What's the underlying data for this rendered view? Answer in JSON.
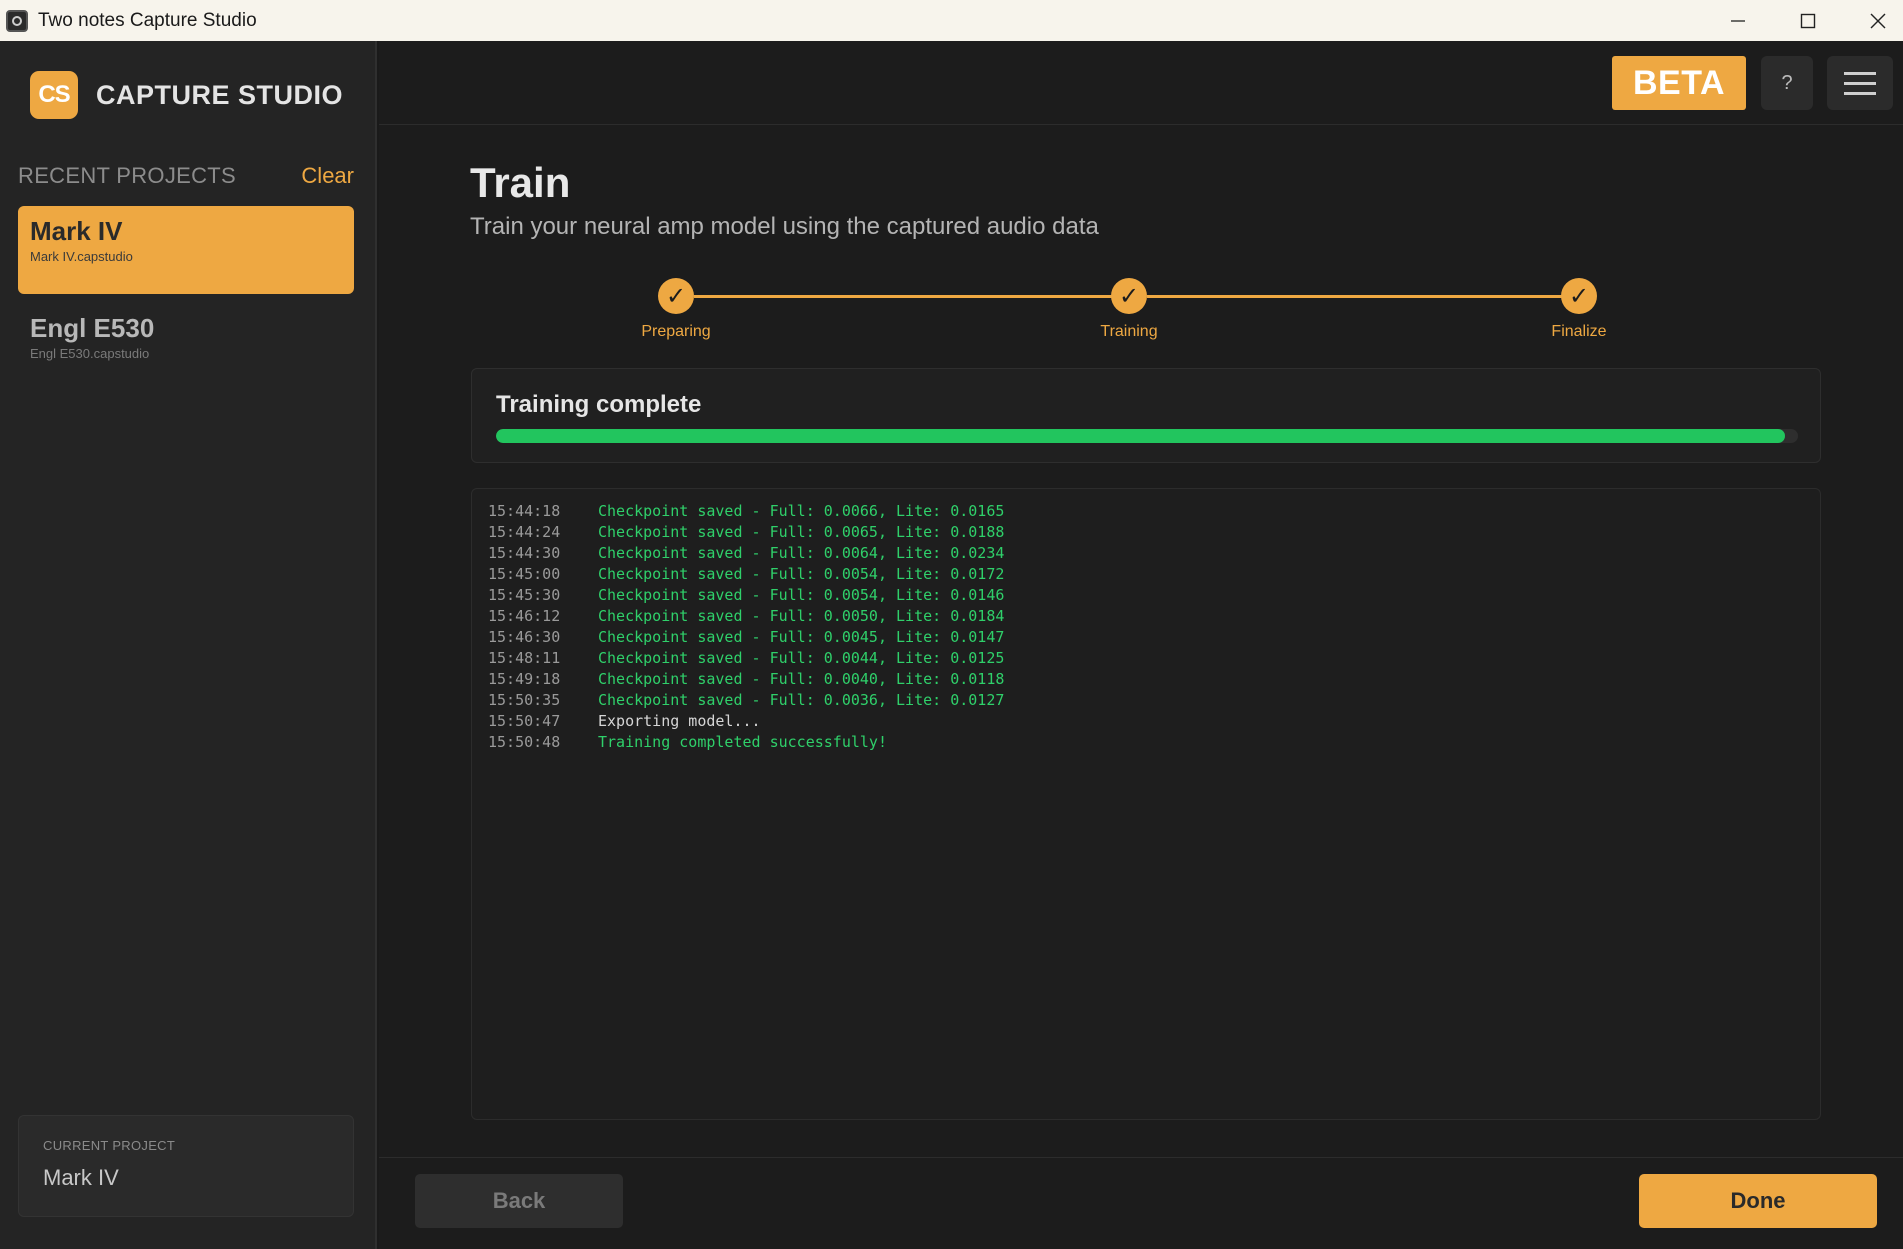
{
  "window": {
    "title": "Two notes Capture Studio",
    "minimize_icon": "minimize-icon",
    "maximize_icon": "maximize-icon",
    "close_icon": "close-icon"
  },
  "sidebar": {
    "logo_badge": "CS",
    "logo_text": "CAPTURE STUDIO",
    "recent_label": "RECENT PROJECTS",
    "clear_label": "Clear",
    "projects": [
      {
        "name": "Mark IV",
        "file": "Mark IV.capstudio",
        "active": true
      },
      {
        "name": "Engl E530",
        "file": "Engl E530.capstudio",
        "active": false
      }
    ],
    "current_label": "CURRENT PROJECT",
    "current_name": "Mark IV"
  },
  "header": {
    "beta_label": "BETA",
    "help_label": "?",
    "menu_icon": "hamburger-menu-icon"
  },
  "page": {
    "title": "Train",
    "subtitle": "Train your neural amp model using the captured audio data"
  },
  "steps": [
    {
      "label": "Preparing",
      "check": "✓"
    },
    {
      "label": "Training",
      "check": "✓"
    },
    {
      "label": "Finalize",
      "check": "✓"
    }
  ],
  "status": {
    "title": "Training complete",
    "progress_fraction": 0.99
  },
  "log": [
    {
      "time": "15:44:18",
      "msg": "Checkpoint saved - Full: 0.0066, Lite: 0.0165",
      "color": "green"
    },
    {
      "time": "15:44:24",
      "msg": "Checkpoint saved - Full: 0.0065, Lite: 0.0188",
      "color": "green"
    },
    {
      "time": "15:44:30",
      "msg": "Checkpoint saved - Full: 0.0064, Lite: 0.0234",
      "color": "green"
    },
    {
      "time": "15:45:00",
      "msg": "Checkpoint saved - Full: 0.0054, Lite: 0.0172",
      "color": "green"
    },
    {
      "time": "15:45:30",
      "msg": "Checkpoint saved - Full: 0.0054, Lite: 0.0146",
      "color": "green"
    },
    {
      "time": "15:46:12",
      "msg": "Checkpoint saved - Full: 0.0050, Lite: 0.0184",
      "color": "green"
    },
    {
      "time": "15:46:30",
      "msg": "Checkpoint saved - Full: 0.0045, Lite: 0.0147",
      "color": "green"
    },
    {
      "time": "15:48:11",
      "msg": "Checkpoint saved - Full: 0.0044, Lite: 0.0125",
      "color": "green"
    },
    {
      "time": "15:49:18",
      "msg": "Checkpoint saved - Full: 0.0040, Lite: 0.0118",
      "color": "green"
    },
    {
      "time": "15:50:35",
      "msg": "Checkpoint saved - Full: 0.0036, Lite: 0.0127",
      "color": "green"
    },
    {
      "time": "15:50:47",
      "msg": "Exporting model...",
      "color": "white"
    },
    {
      "time": "15:50:48",
      "msg": "Training completed successfully!",
      "color": "green"
    }
  ],
  "footer": {
    "back_label": "Back",
    "done_label": "Done"
  },
  "colors": {
    "accent": "#eea842",
    "progress": "#22c55e",
    "log_green": "#2fd06a"
  }
}
